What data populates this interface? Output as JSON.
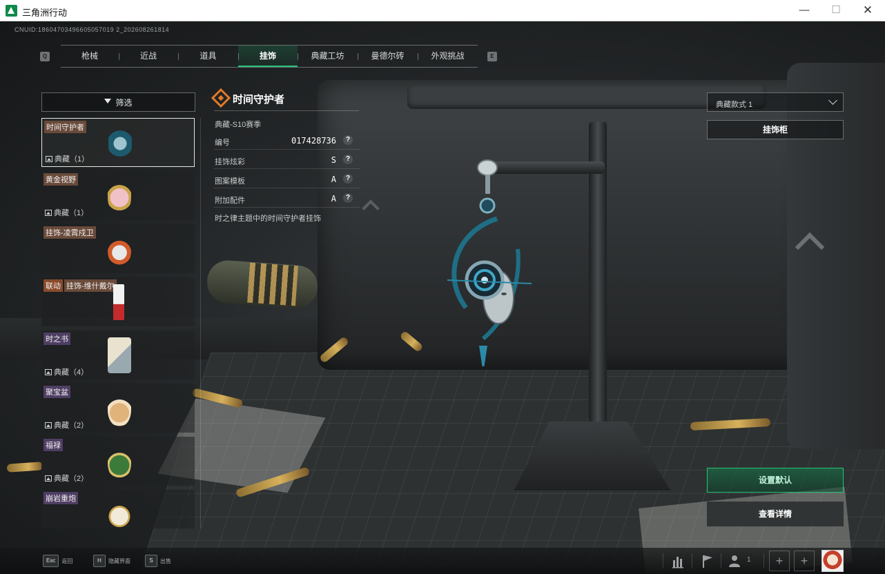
{
  "window": {
    "title": "三角洲行动",
    "minimize": "—",
    "maximize": "☐",
    "close": "✕"
  },
  "uid": "CNUID:18604703496605057019 2_202608261814",
  "nav": {
    "left_key": "Q",
    "right_key": "E",
    "tabs": [
      "枪械",
      "近战",
      "道具",
      "挂饰",
      "典藏工坊",
      "曼德尔砖",
      "外观挑战"
    ],
    "active_tab": "挂饰"
  },
  "filter": {
    "label": "筛选"
  },
  "items": [
    {
      "name": "时间守护者",
      "count": "典藏（1）",
      "selected": true
    },
    {
      "name": "黄金视野",
      "count": "典藏（1）",
      "selected": false
    },
    {
      "name": "挂饰-凌霄戍卫",
      "count": "",
      "selected": false
    },
    {
      "tag": "联动",
      "name": "挂饰-维什戴尔",
      "count": "",
      "selected": false
    },
    {
      "name": "时之书",
      "count": "典藏（4）",
      "selected": false
    },
    {
      "name": "聚宝盆",
      "count": "典藏（2）",
      "selected": false
    },
    {
      "name": "福禄",
      "count": "典藏（2）",
      "selected": false
    },
    {
      "name": "崩岩重炮",
      "count": "",
      "selected": false
    }
  ],
  "detail": {
    "title": "时间守护者",
    "season": "典藏-S10赛季",
    "rows": [
      {
        "label": "编号",
        "value": "017428736"
      },
      {
        "label": "挂饰炫彩",
        "value": "S"
      },
      {
        "label": "图案模板",
        "value": "A"
      },
      {
        "label": "附加配件",
        "value": "A"
      }
    ],
    "help": "?",
    "description": "时之律主题中的时间守护者挂饰"
  },
  "right_panel": {
    "style_select": "典藏款式 1",
    "cabinet_button": "挂饰柜",
    "set_default_button": "设置默认",
    "details_button": "查看详情"
  },
  "bottom": {
    "hints": [
      {
        "key": "Esc",
        "label": "返回"
      },
      {
        "key": "H",
        "label": "隐藏界面"
      },
      {
        "key": "S",
        "label": "出售"
      }
    ],
    "team_count": "1",
    "plus": "+"
  },
  "colors": {
    "accent_green": "#26c47a",
    "legendary_orange": "#e07a2a",
    "tag_brown": "#6a4a3a",
    "tag_purple": "#4f3e63"
  }
}
